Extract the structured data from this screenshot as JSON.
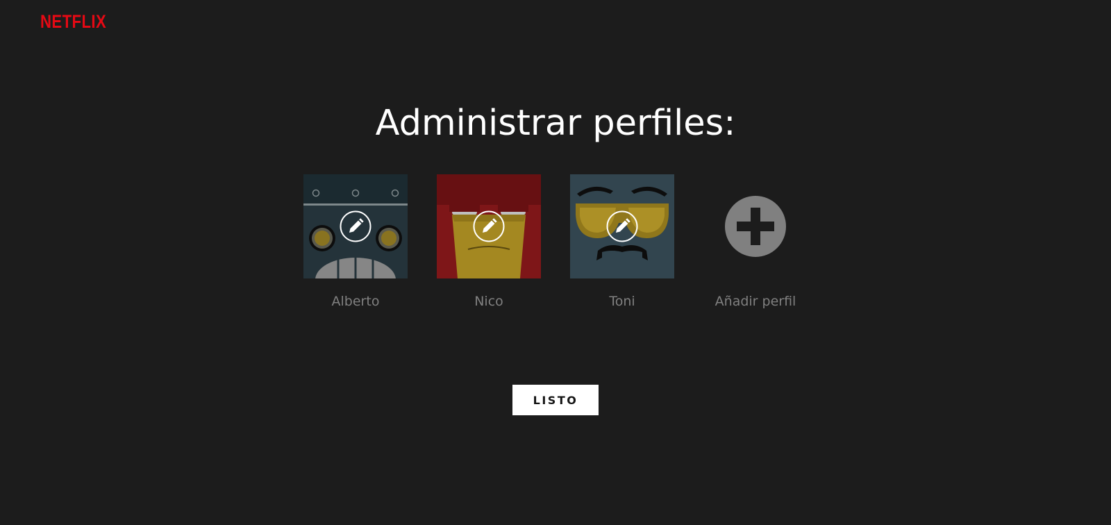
{
  "header": {
    "logo_text": "NETFLIX"
  },
  "main": {
    "title": "Administrar perfiles:",
    "profiles": [
      {
        "name": "Alberto",
        "avatar": "robot-avatar",
        "icon": "pencil-icon"
      },
      {
        "name": "Nico",
        "avatar": "red-character-avatar",
        "icon": "pencil-icon"
      },
      {
        "name": "Toni",
        "avatar": "sunglasses-avatar",
        "icon": "pencil-icon"
      }
    ],
    "add_profile": {
      "label": "Añadir perfil",
      "icon": "plus-circle-icon"
    },
    "done_label": "LISTO"
  },
  "colors": {
    "background": "#1c1c1c",
    "brand": "#e50914",
    "text_muted": "#808080",
    "button_bg": "#ffffff"
  }
}
